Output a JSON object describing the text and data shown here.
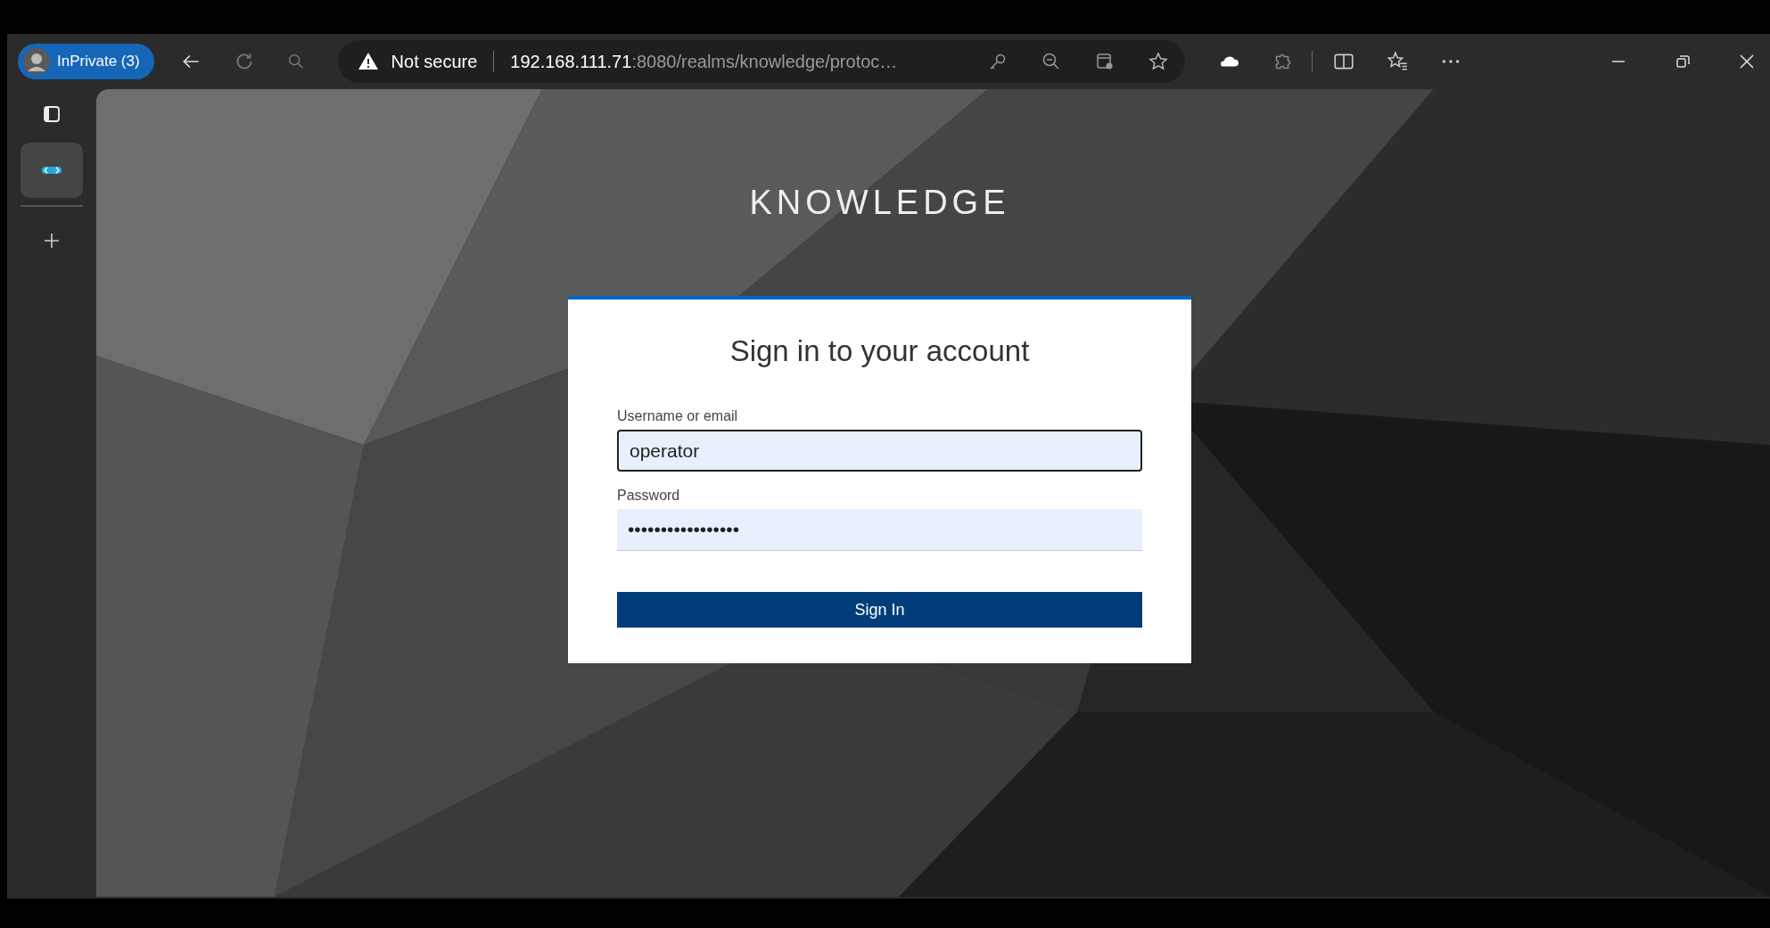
{
  "browser": {
    "profile": {
      "label": "InPrivate (3)"
    },
    "address_bar": {
      "security": "Not secure",
      "host": "192.168.111.71",
      "path": ":8080/realms/knowledge/protoc…"
    }
  },
  "page": {
    "brand": "KNOWLEDGE",
    "card": {
      "title": "Sign in to your account",
      "fields": [
        {
          "label": "Username or email",
          "value": "operator",
          "focused": true
        },
        {
          "label": "Password",
          "value": "•••••••••••••••••",
          "focused": false
        }
      ],
      "button": "Sign In"
    }
  }
}
